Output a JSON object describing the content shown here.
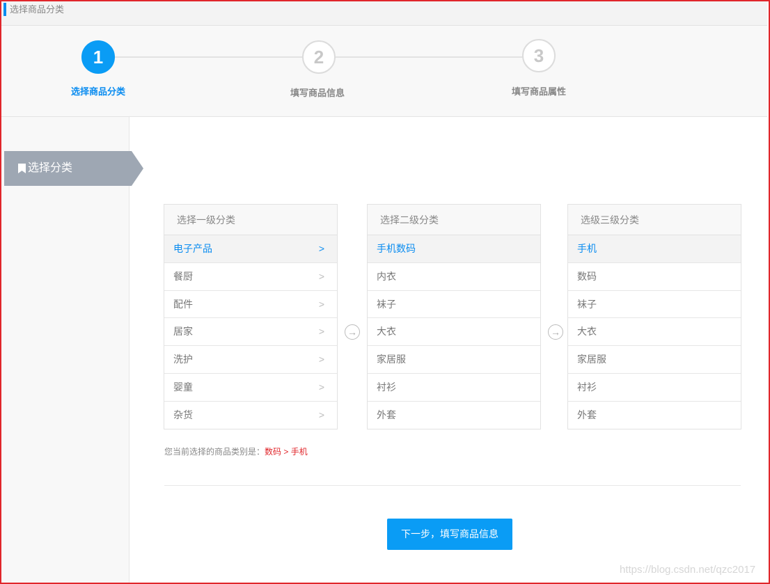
{
  "header": {
    "title": "选择商品分类"
  },
  "steps": [
    {
      "number": "1",
      "label": "选择商品分类",
      "state": "active"
    },
    {
      "number": "2",
      "label": "填写商品信息",
      "state": "idle"
    },
    {
      "number": "3",
      "label": "填写商品属性",
      "state": "idle"
    }
  ],
  "sidebar": {
    "tab_label": "选择分类",
    "tab_icon": "bookmark-icon"
  },
  "panels": [
    {
      "title": "选择一级分类",
      "items": [
        "电子产品",
        "餐厨",
        "配件",
        "居家",
        "洗护",
        "婴童",
        "杂货"
      ],
      "selected_index": 0
    },
    {
      "title": "选择二级分类",
      "items": [
        "手机数码",
        "内衣",
        "袜子",
        "大衣",
        "家居服",
        "衬衫",
        "外套"
      ],
      "selected_index": 0
    },
    {
      "title": "选级三级分类",
      "items": [
        "手机",
        "数码",
        "袜子",
        "大衣",
        "家居服",
        "衬衫",
        "外套"
      ],
      "selected_index": 0
    }
  ],
  "current_selection": {
    "label": "您当前选择的商品类别是：",
    "value": "数码 > 手机"
  },
  "next_button": {
    "label": "下一步，填写商品信息"
  },
  "watermark": "https://blog.csdn.net/qzc2017",
  "colors": {
    "accent": "#0a9cf5",
    "selection_text": "#e0262b",
    "sidebar_tab": "#9ea7b3"
  }
}
